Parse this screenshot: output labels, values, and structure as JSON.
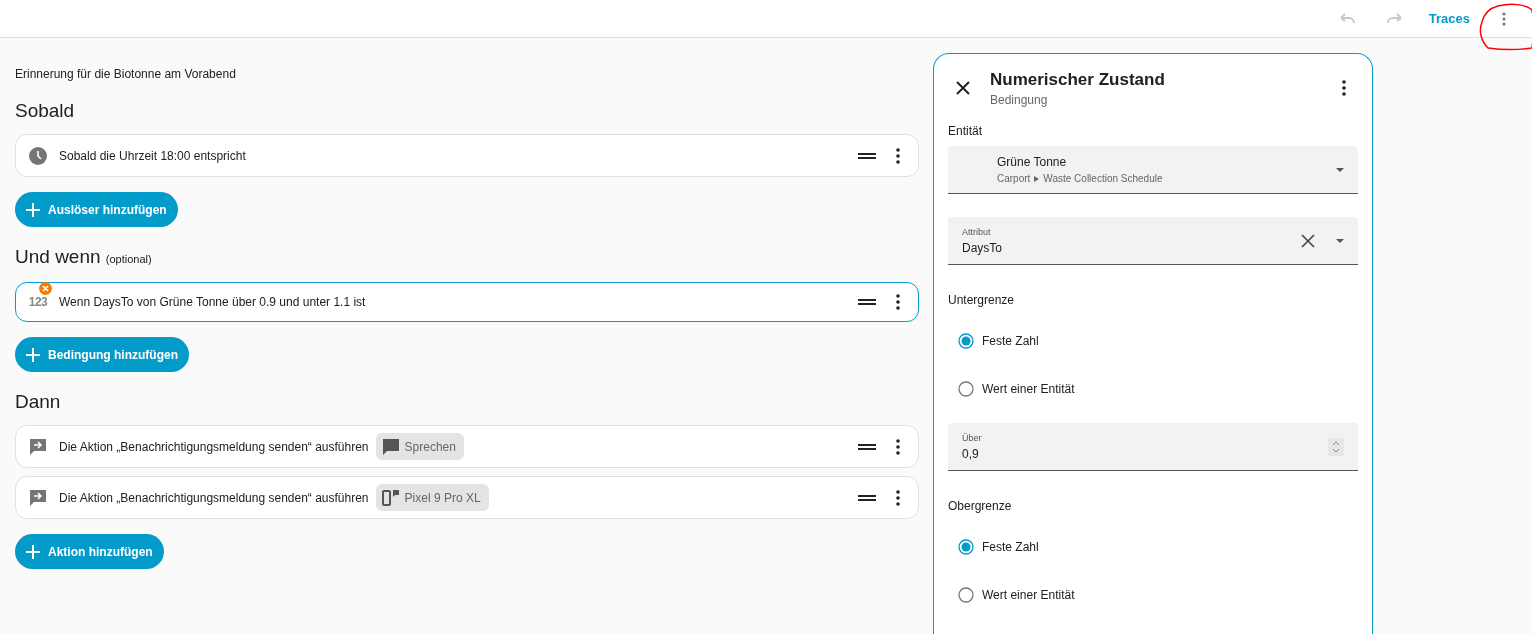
{
  "toolbar": {
    "undo_disabled": true,
    "redo_disabled": true,
    "traces_link": "Traces",
    "menu_annotated": true
  },
  "description": "Erinnerung für die Biotonne am Vorabend",
  "sections": [
    {
      "title": "Sobald",
      "items": [
        {
          "kind": "time",
          "text": "Sobald die Uhrzeit 18:00 entspricht",
          "selected": false,
          "error": false
        }
      ],
      "add_button": "Auslöser hinzufügen"
    },
    {
      "title": "Und wenn",
      "note": "(optional)",
      "items": [
        {
          "kind": "numeric",
          "icon_text": "123",
          "text": "Wenn DaysTo von Grüne Tonne über 0.9 und unter 1.1 ist",
          "selected": true,
          "error": true
        }
      ],
      "add_button": "Bedingung hinzufügen"
    },
    {
      "title": "Dann",
      "items": [
        {
          "kind": "notify",
          "text": "Die Aktion „Benachrichtigungsmeldung senden“ ausführen",
          "chip": {
            "kind": "speech",
            "label": "Sprechen"
          },
          "selected": false,
          "error": false
        },
        {
          "kind": "notify",
          "text": "Die Aktion „Benachrichtigungsmeldung senden“ ausführen",
          "chip": {
            "kind": "device",
            "label": "Pixel 9 Pro XL"
          },
          "selected": false,
          "error": false
        }
      ],
      "add_button": "Aktion hinzufügen"
    }
  ],
  "panel": {
    "title": "Numerischer Zustand",
    "subtitle": "Bedingung",
    "entity_label": "Entität",
    "entity": {
      "name": "Grüne Tonne",
      "area": "Carport",
      "device": "Waste Collection Schedule"
    },
    "attribute": {
      "label": "Attribut",
      "value": "DaysTo"
    },
    "groups": [
      {
        "title": "Untergrenze",
        "options": [
          {
            "label": "Feste Zahl",
            "selected": true
          },
          {
            "label": "Wert einer Entität",
            "selected": false
          }
        ],
        "field": {
          "label": "Über",
          "value": "0,9"
        }
      },
      {
        "title": "Obergrenze",
        "options": [
          {
            "label": "Feste Zahl",
            "selected": true
          },
          {
            "label": "Wert einer Entität",
            "selected": false
          }
        ]
      }
    ]
  }
}
